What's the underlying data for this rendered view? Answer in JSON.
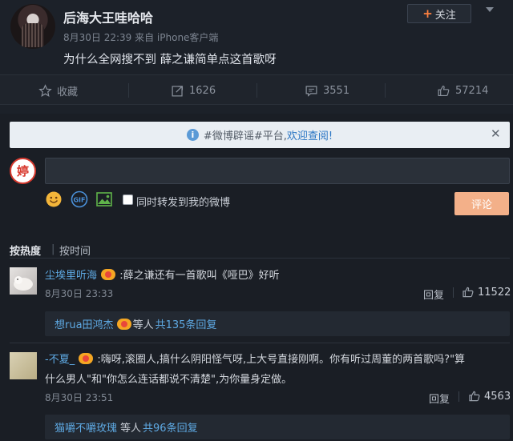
{
  "post": {
    "author": "后海大王哇哈哈",
    "meta": "8月30日 22:39 来自 iPhone客户端",
    "text": "为什么全网搜不到 薛之谦简单点这首歌呀",
    "follow_label": "关注"
  },
  "actions": {
    "favorite": "收藏",
    "repost_count": "1626",
    "comment_count": "3551",
    "like_count": "57214"
  },
  "notice": {
    "tag": "#微博辟谣#平台,",
    "link": "欢迎查阅!"
  },
  "composer": {
    "avatar_char": "婷",
    "sync_label": "同时转发到我的微博",
    "submit_label": "评论"
  },
  "sort": {
    "hot": "按热度",
    "separator": "|",
    "time": "按时间"
  },
  "comments": [
    {
      "name": "尘埃里听海",
      "text": ":薛之谦还有一首歌叫《哑巴》好听",
      "time": "8月30日 23:33",
      "reply": "回复",
      "likes": "11522",
      "sub_name": "想rua田鸿杰",
      "sub_mid": "等人",
      "sub_count": "共135条回复"
    },
    {
      "name": "-不夏_",
      "text_line1": ":嗨呀,滚圈人,搞什么阴阳怪气呀,上大号直接刚啊。你有听过周董的两首歌吗?\"算",
      "text_line2": "什么男人\"和\"你怎么连话都说不清楚\",为你量身定做。",
      "time": "8月30日 23:51",
      "reply": "回复",
      "likes": "4563",
      "sub_name": "猫嚼不嚼玫瑰",
      "sub_mid": "等人",
      "sub_count": "共96条回复"
    }
  ],
  "colors": {
    "background": "#1c2129",
    "link": "#5ea9e3",
    "accent": "#ff8140",
    "submit": "#f3b089"
  }
}
